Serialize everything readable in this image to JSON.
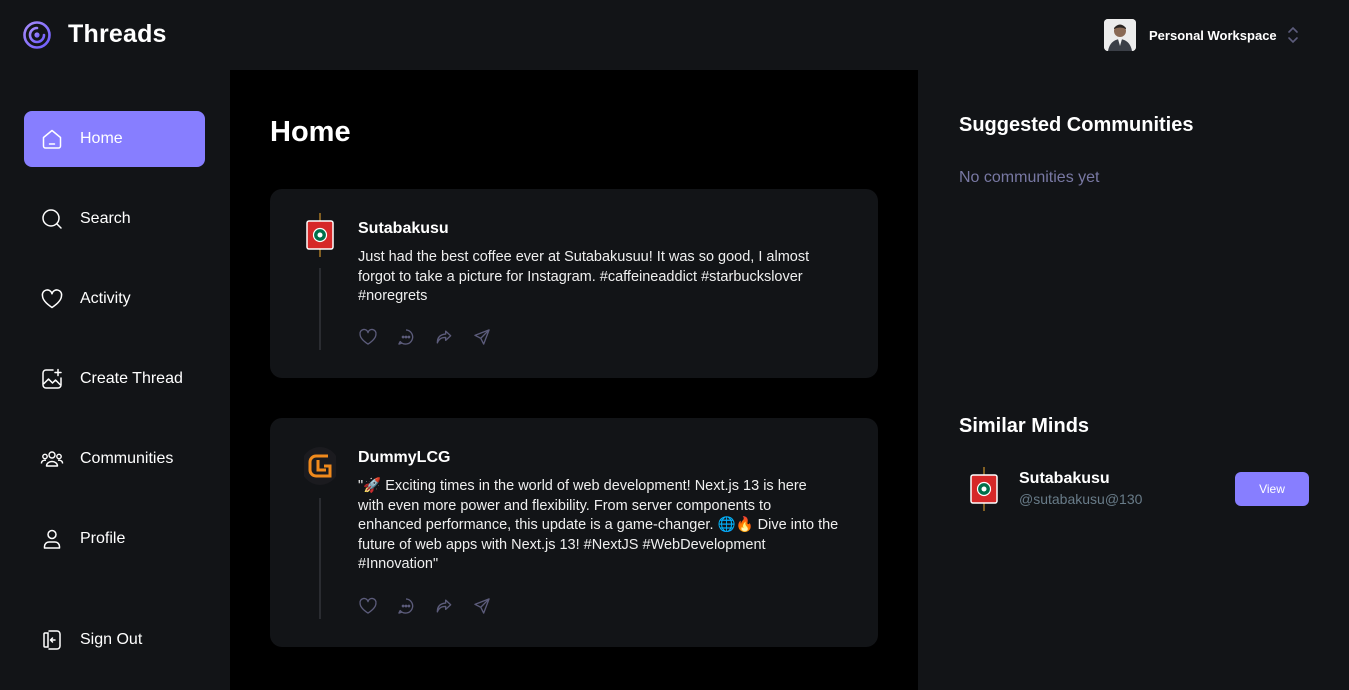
{
  "app": {
    "brand": "Threads"
  },
  "workspace": {
    "name": "Personal Workspace"
  },
  "sidebar": {
    "items": [
      {
        "label": "Home",
        "icon": "home-icon",
        "active": true
      },
      {
        "label": "Search",
        "icon": "search-icon"
      },
      {
        "label": "Activity",
        "icon": "heart-icon"
      },
      {
        "label": "Create Thread",
        "icon": "create-image-icon"
      },
      {
        "label": "Communities",
        "icon": "people-icon"
      },
      {
        "label": "Profile",
        "icon": "user-icon"
      }
    ],
    "signout": {
      "label": "Sign Out",
      "icon": "sign-out-icon"
    }
  },
  "main": {
    "title": "Home",
    "threads": [
      {
        "author": "Sutabakusu",
        "lines": [
          "Just had the best coffee ever at Sutabakusuu! It was so good, I almost",
          "forgot to take a picture for Instagram. #caffeineaddict #starbuckslover",
          "#noregrets"
        ]
      },
      {
        "author": "DummyLCG",
        "lines": [
          "\"🚀 Exciting times in the world of web development! Next.js 13 is here",
          "with even more power and flexibility. From server components to",
          "enhanced performance, this update is a game-changer. 🌐🔥 Dive into the",
          "future of web apps with Next.js 13! #NextJS #WebDevelopment",
          "#Innovation\""
        ]
      }
    ]
  },
  "right": {
    "suggested_title": "Suggested Communities",
    "suggested_empty": "No communities yet",
    "similar_title": "Similar Minds",
    "similar_user": {
      "name": "Sutabakusu",
      "handle": "@sutabakusu@130",
      "button": "View"
    }
  },
  "colors": {
    "accent": "#877eff",
    "bg": "#121417",
    "main_bg": "#000000",
    "muted": "#7878a3"
  }
}
